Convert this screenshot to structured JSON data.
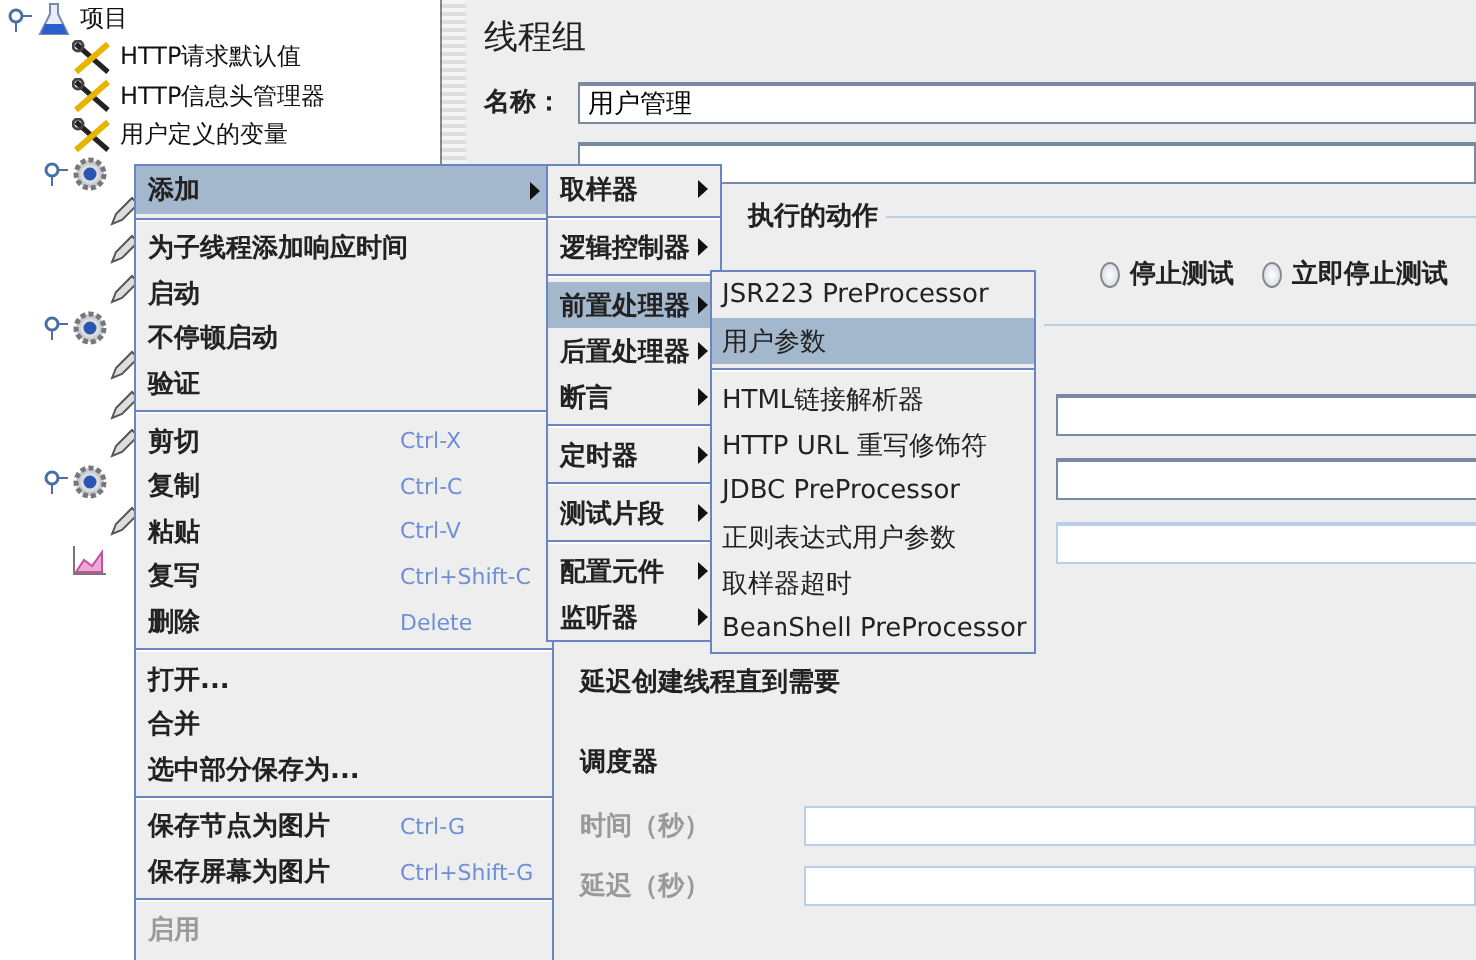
{
  "tree": {
    "label": "项目",
    "kind": "plan",
    "expanded": true,
    "children": [
      {
        "label": "HTTP请求默认值",
        "kind": "config"
      },
      {
        "label": "HTTP信息头管理器",
        "kind": "config"
      },
      {
        "label": "用户定义的变量",
        "kind": "config"
      },
      {
        "kind": "thread",
        "expanded": true,
        "children": [
          {
            "kind": "sampler"
          },
          {
            "kind": "sampler"
          },
          {
            "kind": "sampler"
          }
        ]
      },
      {
        "kind": "thread",
        "expanded": true,
        "children": [
          {
            "kind": "sampler"
          },
          {
            "kind": "sampler"
          },
          {
            "kind": "sampler"
          }
        ]
      },
      {
        "kind": "thread",
        "expanded": true,
        "children": [
          {
            "kind": "sampler"
          }
        ]
      },
      {
        "kind": "listener"
      }
    ]
  },
  "panel": {
    "title": "线程组",
    "name_label": "名称：",
    "name_value": "用户管理",
    "error_action_label": "执行的动作",
    "radios": [
      {
        "label": "停止测试",
        "selected": false
      },
      {
        "label": "立即停止测试",
        "selected": false
      }
    ],
    "delay_label": "延迟创建线程直到需要",
    "scheduler_label": "调度器",
    "duration_label": "时间（秒）",
    "startup_delay_label": "延迟（秒）"
  },
  "context_menu": [
    [
      {
        "label": "添加",
        "submenu": true,
        "selected": true,
        "disabled": false
      }
    ],
    [
      {
        "label": "为子线程添加响应时间",
        "submenu": false,
        "selected": false,
        "disabled": false
      },
      {
        "label": "启动",
        "submenu": false,
        "selected": false,
        "disabled": false
      },
      {
        "label": "不停顿启动",
        "submenu": false,
        "selected": false,
        "disabled": false
      },
      {
        "label": "验证",
        "submenu": false,
        "selected": false,
        "disabled": false
      }
    ],
    [
      {
        "label": "剪切",
        "shortcut": "Ctrl-X",
        "submenu": false,
        "selected": false,
        "disabled": false
      },
      {
        "label": "复制",
        "shortcut": "Ctrl-C",
        "submenu": false,
        "selected": false,
        "disabled": false
      },
      {
        "label": "粘贴",
        "shortcut": "Ctrl-V",
        "submenu": false,
        "selected": false,
        "disabled": false
      },
      {
        "label": "复写",
        "shortcut": "Ctrl+Shift-C",
        "submenu": false,
        "selected": false,
        "disabled": false
      },
      {
        "label": "删除",
        "shortcut": "Delete",
        "submenu": false,
        "selected": false,
        "disabled": false
      }
    ],
    [
      {
        "label": "打开...",
        "submenu": false,
        "selected": false,
        "disabled": false
      },
      {
        "label": "合并",
        "submenu": false,
        "selected": false,
        "disabled": false
      },
      {
        "label": "选中部分保存为...",
        "submenu": false,
        "selected": false,
        "disabled": false
      }
    ],
    [
      {
        "label": "保存节点为图片",
        "shortcut": "Ctrl-G",
        "submenu": false,
        "selected": false,
        "disabled": false
      },
      {
        "label": "保存屏幕为图片",
        "shortcut": "Ctrl+Shift-G",
        "submenu": false,
        "selected": false,
        "disabled": false
      }
    ],
    [
      {
        "label": "启用",
        "submenu": false,
        "selected": false,
        "disabled": true
      }
    ]
  ],
  "add_submenu": [
    [
      {
        "label": "取样器",
        "submenu": true,
        "selected": false
      }
    ],
    [
      {
        "label": "逻辑控制器",
        "submenu": true,
        "selected": false
      }
    ],
    [
      {
        "label": "前置处理器",
        "submenu": true,
        "selected": true
      },
      {
        "label": "后置处理器",
        "submenu": true,
        "selected": false
      },
      {
        "label": "断言",
        "submenu": true,
        "selected": false
      }
    ],
    [
      {
        "label": "定时器",
        "submenu": true,
        "selected": false
      }
    ],
    [
      {
        "label": "测试片段",
        "submenu": true,
        "selected": false
      }
    ],
    [
      {
        "label": "配置元件",
        "submenu": true,
        "selected": false
      },
      {
        "label": "监听器",
        "submenu": true,
        "selected": false
      }
    ]
  ],
  "preprocessor_submenu": [
    [
      {
        "label": "JSR223 PreProcessor",
        "selected": false
      },
      {
        "label": "用户参数",
        "selected": true
      }
    ],
    [
      {
        "label": "HTML链接解析器",
        "selected": false
      },
      {
        "label": "HTTP URL 重写修饰符",
        "selected": false
      },
      {
        "label": "JDBC PreProcessor",
        "selected": false
      },
      {
        "label": "正则表达式用户参数",
        "selected": false
      },
      {
        "label": "取样器超时",
        "selected": false
      },
      {
        "label": "BeanShell PreProcessor",
        "selected": false
      }
    ]
  ]
}
